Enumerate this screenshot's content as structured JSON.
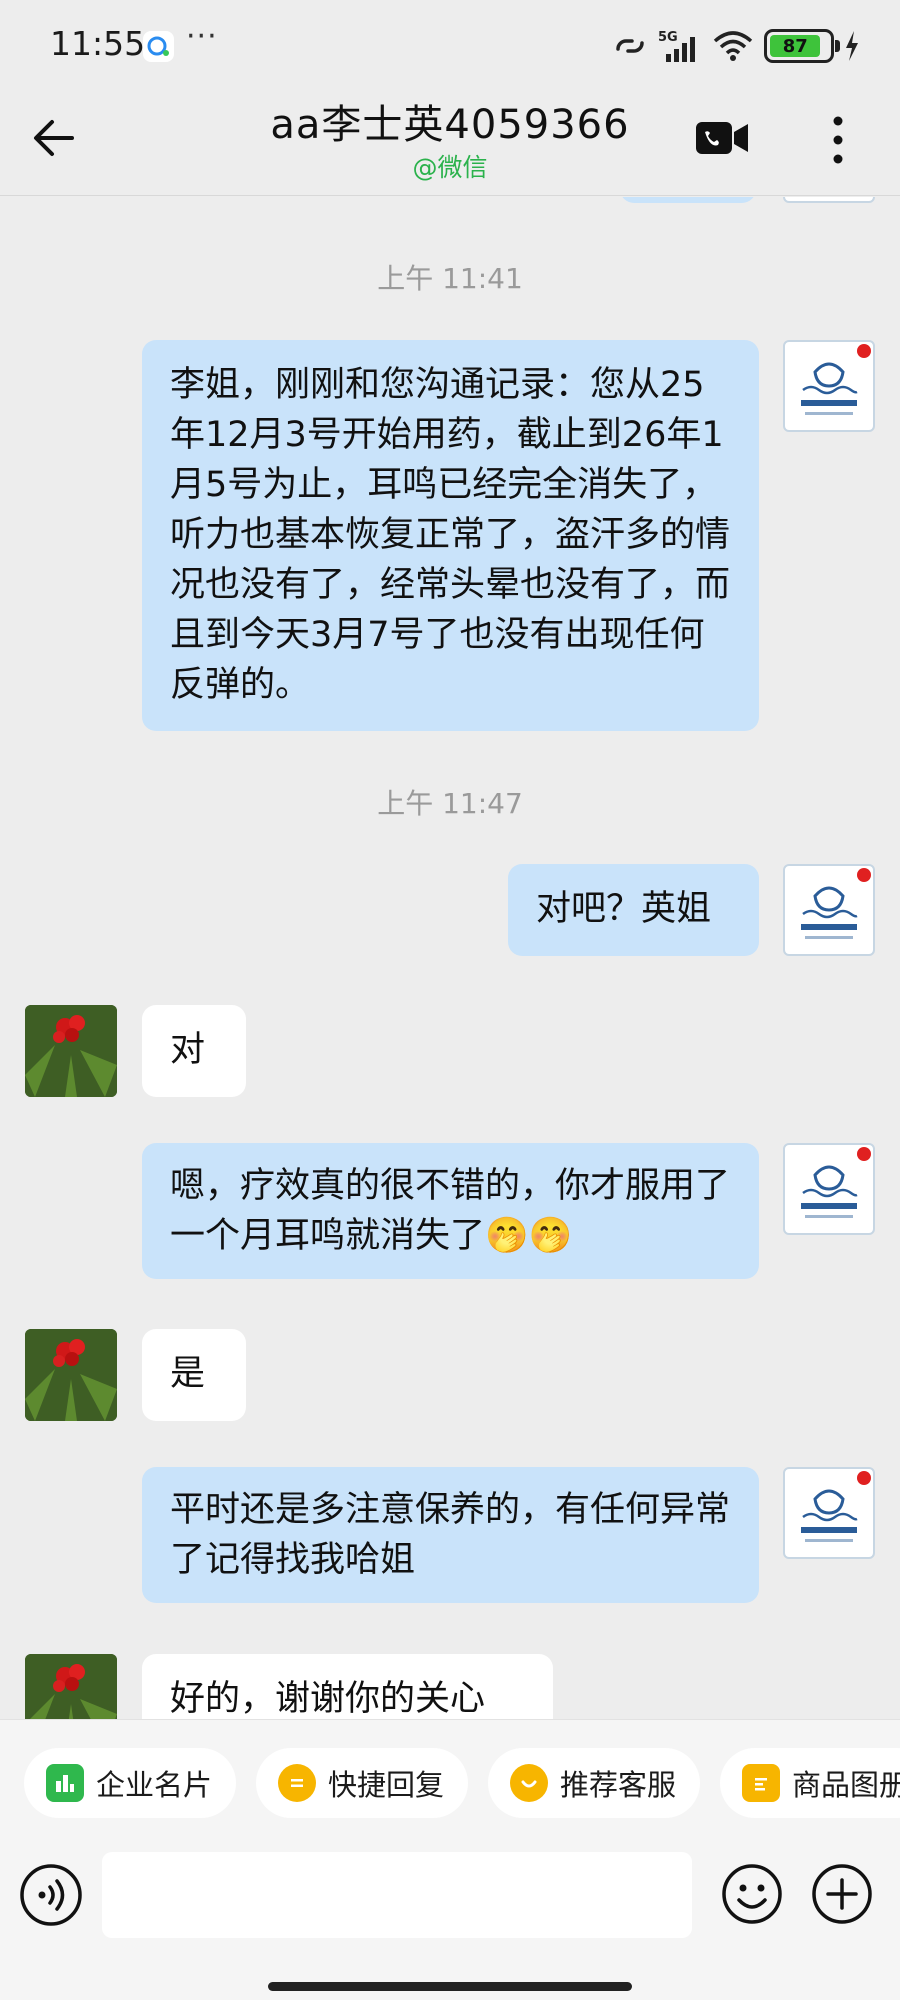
{
  "status_bar": {
    "time": "11:55",
    "more": "···",
    "network": "5G",
    "battery": "87"
  },
  "header": {
    "title": "aa李士英4059366",
    "subtitle": "@微信"
  },
  "messages": {
    "ts1": "上午 11:41",
    "m1": "李姐，刚刚和您沟通记录：您从25年12月3号开始用药，截止到26年1月5号为止，耳鸣已经完全消失了，听力也基本恢复正常了，盗汗多的情况也没有了，经常头晕也没有了，而且到今天3月7号了也没有出现任何反弹的。",
    "ts2": "上午 11:47",
    "m2": "对吧？英姐",
    "m3": "对",
    "m4": "嗯，疗效真的很不错的，你才服用了一个月耳鸣就消失了🤭🤭",
    "m5": "是",
    "m6": "平时还是多注意保养的，有任何异常了记得找我哈姐",
    "m7": "好的，谢谢你的关心"
  },
  "toolbar": {
    "chips": [
      "企业名片",
      "快捷回复",
      "推荐客服",
      "商品图册"
    ]
  },
  "colors": {
    "bubble_sent": "#c9e3fa",
    "bubble_received": "#ffffff",
    "accent_green": "#2bb24c",
    "background": "#ededed"
  }
}
